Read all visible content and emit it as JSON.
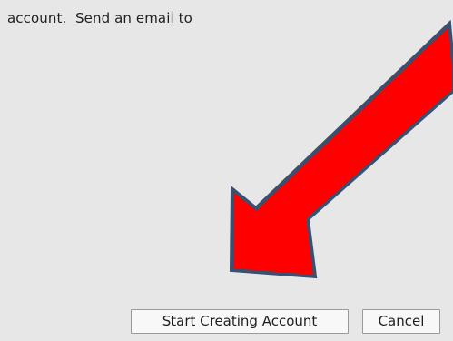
{
  "dialog": {
    "instruction_text": "account.  Send an email to"
  },
  "buttons": {
    "start_label": "Start Creating Account",
    "cancel_label": "Cancel"
  },
  "colors": {
    "background": "#e7e7e7",
    "arrow_fill": "#ff0000",
    "arrow_outline": "#3b4f6e"
  },
  "icons": {
    "annotation": "red-arrow-icon"
  }
}
